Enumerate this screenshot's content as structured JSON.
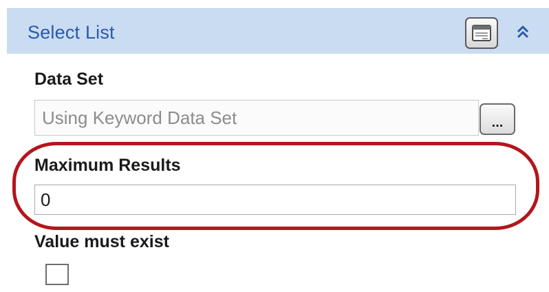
{
  "section": {
    "title": "Select List",
    "popup_icon": "window-icon",
    "collapse_icon": "double-chevron-up-icon"
  },
  "data_set": {
    "label": "Data Set",
    "value": "Using Keyword Data Set",
    "browse_label": "..."
  },
  "maximum_results": {
    "label": "Maximum Results",
    "value": "0"
  },
  "value_must_exist": {
    "label": "Value must exist",
    "checked": false
  },
  "colors": {
    "header_bg": "#c9dcf2",
    "header_text": "#2b5aa8",
    "highlight": "#b3161c"
  }
}
